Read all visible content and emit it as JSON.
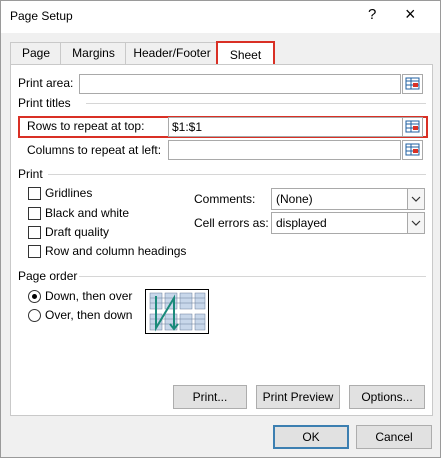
{
  "window": {
    "title": "Page Setup",
    "help_label": "?",
    "close_label": "×"
  },
  "tabs": [
    {
      "label": "Page"
    },
    {
      "label": "Margins"
    },
    {
      "label": "Header/Footer"
    },
    {
      "label": "Sheet",
      "active": true
    }
  ],
  "sheet": {
    "print_area": {
      "label": "Print area:",
      "value": ""
    },
    "print_titles_group": "Print titles",
    "rows_to_repeat": {
      "label": "Rows to repeat at top:",
      "value": "$1:$1"
    },
    "columns_to_repeat": {
      "label": "Columns to repeat at left:",
      "value": ""
    },
    "print_group": "Print",
    "checkboxes": [
      {
        "label": "Gridlines",
        "checked": false
      },
      {
        "label": "Black and white",
        "checked": false
      },
      {
        "label": "Draft quality",
        "checked": false
      },
      {
        "label": "Row and column headings",
        "checked": false
      }
    ],
    "comments": {
      "label": "Comments:",
      "value": "(None)"
    },
    "cell_errors": {
      "label": "Cell errors as:",
      "value": "displayed"
    },
    "page_order_group": "Page order",
    "page_order_options": [
      {
        "label": "Down, then over",
        "selected": true
      },
      {
        "label": "Over, then down",
        "selected": false
      }
    ]
  },
  "panel_buttons": {
    "print": "Print...",
    "print_preview": "Print Preview",
    "options": "Options..."
  },
  "dialog_buttons": {
    "ok": "OK",
    "cancel": "Cancel"
  },
  "colors": {
    "highlight": "#d93025",
    "accent": "#3c7fb1"
  },
  "icons": {
    "collapse_dialog": "range-picker-icon",
    "dropdown": "chevron-down-icon"
  }
}
